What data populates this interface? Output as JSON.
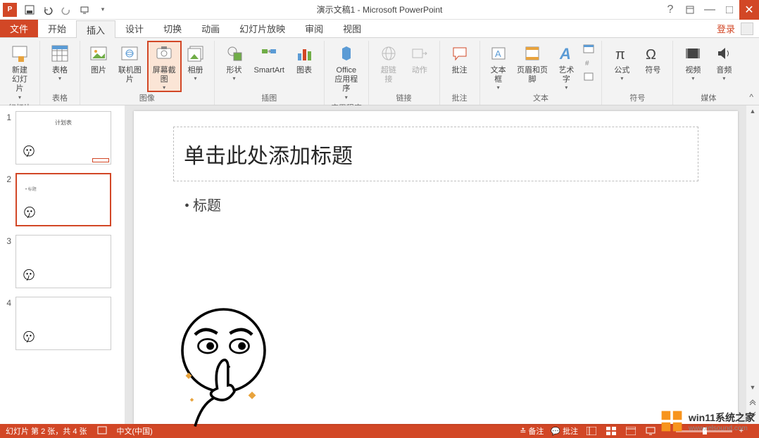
{
  "titlebar": {
    "app_icon_text": "P",
    "title": "演示文稿1 - Microsoft PowerPoint",
    "help": "?"
  },
  "tabs": {
    "file": "文件",
    "items": [
      "开始",
      "插入",
      "设计",
      "切换",
      "动画",
      "幻灯片放映",
      "审阅",
      "视图"
    ],
    "active_index": 1,
    "login": "登录"
  },
  "ribbon": {
    "groups": [
      {
        "label": "幻灯片",
        "items": [
          {
            "name": "new-slide",
            "label": "新建\n幻灯片",
            "dropdown": true
          }
        ]
      },
      {
        "label": "表格",
        "items": [
          {
            "name": "table",
            "label": "表格",
            "dropdown": true
          }
        ]
      },
      {
        "label": "图像",
        "items": [
          {
            "name": "picture",
            "label": "图片"
          },
          {
            "name": "online-picture",
            "label": "联机图片"
          },
          {
            "name": "screenshot",
            "label": "屏幕截图",
            "dropdown": true,
            "highlighted": true
          },
          {
            "name": "album",
            "label": "相册",
            "dropdown": true
          }
        ]
      },
      {
        "label": "插图",
        "items": [
          {
            "name": "shapes",
            "label": "形状",
            "dropdown": true
          },
          {
            "name": "smartart",
            "label": "SmartArt"
          },
          {
            "name": "chart",
            "label": "图表"
          }
        ]
      },
      {
        "label": "应用程序",
        "items": [
          {
            "name": "office-apps",
            "label": "Office\n应用程序",
            "dropdown": true
          }
        ]
      },
      {
        "label": "链接",
        "items": [
          {
            "name": "hyperlink",
            "label": "超链接",
            "disabled": true
          },
          {
            "name": "action",
            "label": "动作",
            "disabled": true
          }
        ]
      },
      {
        "label": "批注",
        "items": [
          {
            "name": "comment",
            "label": "批注"
          }
        ]
      },
      {
        "label": "文本",
        "items": [
          {
            "name": "textbox",
            "label": "文本框",
            "dropdown": true
          },
          {
            "name": "header-footer",
            "label": "页眉和页脚"
          },
          {
            "name": "wordart",
            "label": "艺术字",
            "dropdown": true
          }
        ],
        "extra": true
      },
      {
        "label": "符号",
        "items": [
          {
            "name": "equation",
            "label": "公式",
            "dropdown": true
          },
          {
            "name": "symbol",
            "label": "符号"
          }
        ]
      },
      {
        "label": "媒体",
        "items": [
          {
            "name": "video",
            "label": "视频",
            "dropdown": true
          },
          {
            "name": "audio",
            "label": "音频",
            "dropdown": true
          }
        ]
      }
    ]
  },
  "slides": {
    "count": 4,
    "selected": 2,
    "thumb1_title": "计划表",
    "thumb2_text": "• 标题"
  },
  "editor": {
    "title_placeholder": "单击此处添加标题",
    "bullet": "标题"
  },
  "statusbar": {
    "slide_info": "幻灯片 第 2 张，共 4 张",
    "language": "中文(中国)",
    "notes": "备注",
    "comments": "批注"
  },
  "watermark": {
    "line1": "win11系统之家",
    "line2": "www.relsound.com"
  }
}
